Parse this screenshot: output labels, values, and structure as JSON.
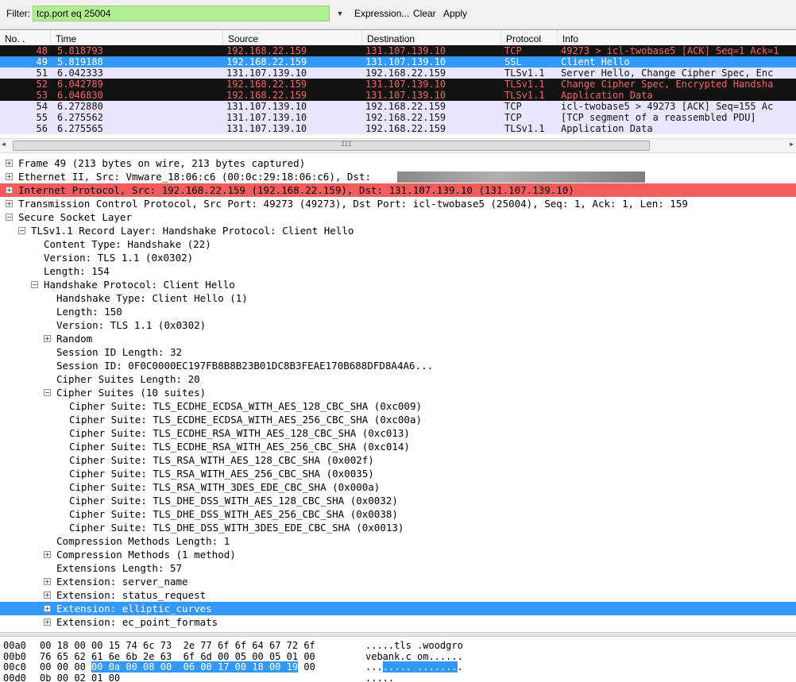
{
  "filter": {
    "label": "Filter:",
    "value": "tcp.port eq 25004",
    "expression_label": "Expression...",
    "clear_label": "Clear",
    "apply_label": "Apply",
    "input_bg": "#b1f08f"
  },
  "packet_list": {
    "columns": [
      "No. .",
      "Time",
      "Source",
      "Destination",
      "Protocol",
      "Info"
    ],
    "rows": [
      {
        "no": "48",
        "time": "5.818793",
        "src": "192.168.22.159",
        "dst": "131.107.139.10",
        "proto": "TCP",
        "info": "49273 > icl-twobase5 [ACK] Seq=1 Ack=1",
        "style": "black"
      },
      {
        "no": "49",
        "time": "5.819188",
        "src": "192.168.22.159",
        "dst": "131.107.139.10",
        "proto": "SSL",
        "info": "Client Hello",
        "style": "selected"
      },
      {
        "no": "51",
        "time": "6.042333",
        "src": "131.107.139.10",
        "dst": "192.168.22.159",
        "proto": "TLSv1.1",
        "info": "Server Hello, Change Cipher Spec, Enc",
        "style": "lavender"
      },
      {
        "no": "52",
        "time": "6.042789",
        "src": "192.168.22.159",
        "dst": "131.107.139.10",
        "proto": "TLSv1.1",
        "info": "Change Cipher Spec, Encrypted Handsha",
        "style": "black"
      },
      {
        "no": "53",
        "time": "6.046830",
        "src": "192.168.22.159",
        "dst": "131.107.139.10",
        "proto": "TLSv1.1",
        "info": "Application Data",
        "style": "black"
      },
      {
        "no": "54",
        "time": "6.272880",
        "src": "131.107.139.10",
        "dst": "192.168.22.159",
        "proto": "TCP",
        "info": "icl-twobase5 > 49273 [ACK] Seq=155 Ac",
        "style": "lavender"
      },
      {
        "no": "55",
        "time": "6.275562",
        "src": "131.107.139.10",
        "dst": "192.168.22.159",
        "proto": "TCP",
        "info": "[TCP segment of a reassembled PDU]",
        "style": "lavender"
      },
      {
        "no": "56",
        "time": "6.275565",
        "src": "131.107.139.10",
        "dst": "192.168.22.159",
        "proto": "TLSv1.1",
        "info": "Application Data",
        "style": "lavender"
      }
    ],
    "colors": {
      "black_bg": "#121212",
      "black_fg": "#f06464",
      "selected_bg": "#3399ff",
      "selected_fg": "#ffffff",
      "lavender_bg": "#e8e7ff",
      "lavender_fg": "#111111"
    }
  },
  "scrollbar": {
    "grip": "III"
  },
  "details": {
    "rows": [
      {
        "indent": 0,
        "expander": "+",
        "text": "Frame 49 (213 bytes on wire, 213 bytes captured)"
      },
      {
        "indent": 0,
        "expander": "+",
        "text": "Ethernet II, Src: Vmware_18:06:c6 (00:0c:29:18:06:c6), Dst:",
        "redacted": true
      },
      {
        "indent": 0,
        "expander": "+",
        "text": "Internet Protocol, Src: 192.168.22.159 (192.168.22.159), Dst: 131.107.139.10 (131.107.139.10)",
        "highlight": "red"
      },
      {
        "indent": 0,
        "expander": "+",
        "text": "Transmission Control Protocol, Src Port: 49273 (49273), Dst Port: icl-twobase5 (25004), Seq: 1, Ack: 1, Len: 159"
      },
      {
        "indent": 0,
        "expander": "-",
        "text": "Secure Socket Layer"
      },
      {
        "indent": 1,
        "expander": "-",
        "text": "TLSv1.1 Record Layer: Handshake Protocol: Client Hello"
      },
      {
        "indent": 2,
        "expander": "",
        "text": "Content Type: Handshake (22)"
      },
      {
        "indent": 2,
        "expander": "",
        "text": "Version: TLS 1.1 (0x0302)"
      },
      {
        "indent": 2,
        "expander": "",
        "text": "Length: 154"
      },
      {
        "indent": 2,
        "expander": "-",
        "text": "Handshake Protocol: Client Hello"
      },
      {
        "indent": 3,
        "expander": "",
        "text": "Handshake Type: Client Hello (1)"
      },
      {
        "indent": 3,
        "expander": "",
        "text": "Length: 150"
      },
      {
        "indent": 3,
        "expander": "",
        "text": "Version: TLS 1.1 (0x0302)"
      },
      {
        "indent": 3,
        "expander": "+",
        "text": "Random"
      },
      {
        "indent": 3,
        "expander": "",
        "text": "Session ID Length: 32"
      },
      {
        "indent": 3,
        "expander": "",
        "text": "Session ID: 0F0C0000EC197FB8B8B23B01DC8B3FEAE170B688DFD8A4A6..."
      },
      {
        "indent": 3,
        "expander": "",
        "text": "Cipher Suites Length: 20"
      },
      {
        "indent": 3,
        "expander": "-",
        "text": "Cipher Suites (10 suites)"
      },
      {
        "indent": 4,
        "expander": "",
        "text": "Cipher Suite: TLS_ECDHE_ECDSA_WITH_AES_128_CBC_SHA (0xc009)"
      },
      {
        "indent": 4,
        "expander": "",
        "text": "Cipher Suite: TLS_ECDHE_ECDSA_WITH_AES_256_CBC_SHA (0xc00a)"
      },
      {
        "indent": 4,
        "expander": "",
        "text": "Cipher Suite: TLS_ECDHE_RSA_WITH_AES_128_CBC_SHA (0xc013)"
      },
      {
        "indent": 4,
        "expander": "",
        "text": "Cipher Suite: TLS_ECDHE_RSA_WITH_AES_256_CBC_SHA (0xc014)"
      },
      {
        "indent": 4,
        "expander": "",
        "text": "Cipher Suite: TLS_RSA_WITH_AES_128_CBC_SHA (0x002f)"
      },
      {
        "indent": 4,
        "expander": "",
        "text": "Cipher Suite: TLS_RSA_WITH_AES_256_CBC_SHA (0x0035)"
      },
      {
        "indent": 4,
        "expander": "",
        "text": "Cipher Suite: TLS_RSA_WITH_3DES_EDE_CBC_SHA (0x000a)"
      },
      {
        "indent": 4,
        "expander": "",
        "text": "Cipher Suite: TLS_DHE_DSS_WITH_AES_128_CBC_SHA (0x0032)"
      },
      {
        "indent": 4,
        "expander": "",
        "text": "Cipher Suite: TLS_DHE_DSS_WITH_AES_256_CBC_SHA (0x0038)"
      },
      {
        "indent": 4,
        "expander": "",
        "text": "Cipher Suite: TLS_DHE_DSS_WITH_3DES_EDE_CBC_SHA (0x0013)"
      },
      {
        "indent": 3,
        "expander": "",
        "text": "Compression Methods Length: 1"
      },
      {
        "indent": 3,
        "expander": "+",
        "text": "Compression Methods (1 method)"
      },
      {
        "indent": 3,
        "expander": "",
        "text": "Extensions Length: 57"
      },
      {
        "indent": 3,
        "expander": "+",
        "text": "Extension: server_name"
      },
      {
        "indent": 3,
        "expander": "+",
        "text": "Extension: status_request"
      },
      {
        "indent": 3,
        "expander": "+",
        "text": "Extension: elliptic_curves",
        "highlight": "blue"
      },
      {
        "indent": 3,
        "expander": "+",
        "text": "Extension: ec_point_formats"
      }
    ]
  },
  "hexdump": {
    "rows": [
      {
        "offset": "00a0",
        "bytes": "00 18 00 00 15 74 6c 73  2e 77 6f 6f 64 67 72 6f",
        "ascii": ".....tls .woodgro"
      },
      {
        "offset": "00b0",
        "bytes": "76 65 62 61 6e 6b 2e 63  6f 6d 00 05 00 05 01 00",
        "ascii": "vebank.c om......"
      },
      {
        "offset": "00c0",
        "bytes_pre": "00 00 00 ",
        "bytes_sel": "00 0a 00 08 00  06 00 17 00 18 00 19",
        "bytes_post": " 00",
        "ascii_pre": "...",
        "ascii_sel": "..... .......",
        "ascii_post": "."
      },
      {
        "offset": "00d0",
        "bytes": "0b 00 02 01 00",
        "ascii": "....."
      }
    ]
  }
}
